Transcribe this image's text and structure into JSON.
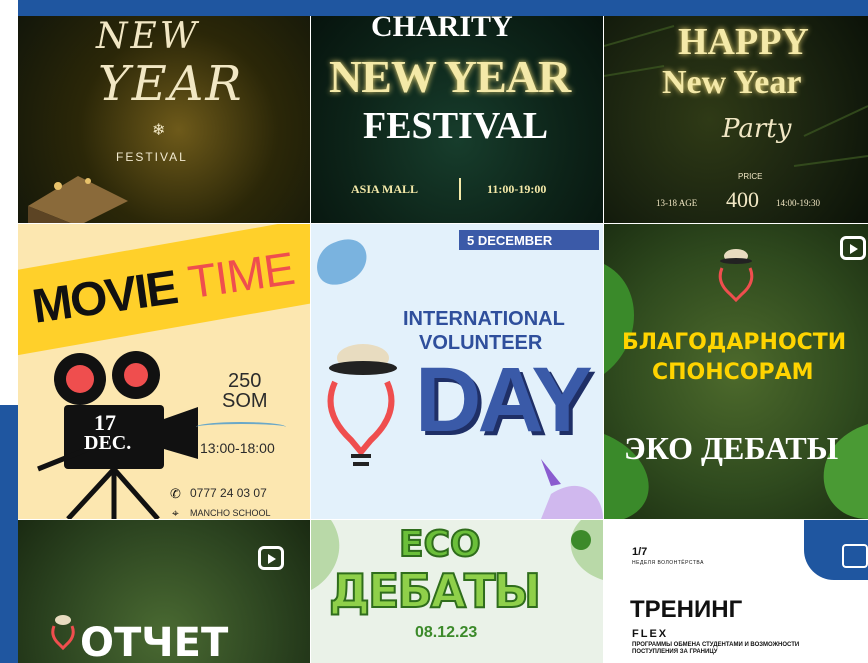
{
  "tiles": {
    "t1": {
      "line1": "NEW",
      "line2": "YEAR",
      "snow": "❄",
      "line3": "FESTIVAL"
    },
    "t2": {
      "line1": "CHARITY",
      "line2": "NEW YEAR",
      "line3": "FESTIVAL",
      "venue": "ASIA MALL",
      "time": "11:00-19:00"
    },
    "t3": {
      "line1": "HAPPY",
      "line2": "New Year",
      "line3": "Party",
      "price_label": "PRICE",
      "age": "13-18 AGE",
      "price": "400",
      "time": "14:00-19:30"
    },
    "t4": {
      "movie": "MOVIE",
      "time_word": "TIME",
      "day": "17",
      "month": "DEC.",
      "price1": "250",
      "price2": "SOM",
      "hours": "13:00-18:00",
      "phone": "0777 24 03 07",
      "place": "MANCHO SCHOOL"
    },
    "t5": {
      "date": "5 DECEMBER",
      "line1": "INTERNATIONAL",
      "line2": "VOLUNTEER",
      "line3": "DAY"
    },
    "t6": {
      "line1": "БЛАГОДАРНОСТИ",
      "line2": "СПОНСОРАМ",
      "line3": "ЭКО ДЕБАТЫ"
    },
    "t7": {
      "title": "ОТЧЕТ"
    },
    "t8": {
      "line1": "ECO",
      "line2": "ДЕБАТЫ",
      "date": "08.12.23"
    },
    "t9": {
      "counter": "1/7",
      "subtitle": "НЕДЕЛЯ ВОЛОНТЁРСТВА",
      "title": "ТРЕНИНГ",
      "flex": "FLEX",
      "desc": "ПРОГРАММЫ ОБМЕНА СТУДЕНТАМИ И ВОЗМОЖНОСТИ ПОСТУПЛЕНИЯ ЗА ГРАНИЦУ"
    }
  },
  "colors": {
    "frame": "#1f56a0",
    "movie_red": "#ef4e4e",
    "day_blue": "#3a5aa8",
    "eco_green": "#6bbf3a"
  }
}
